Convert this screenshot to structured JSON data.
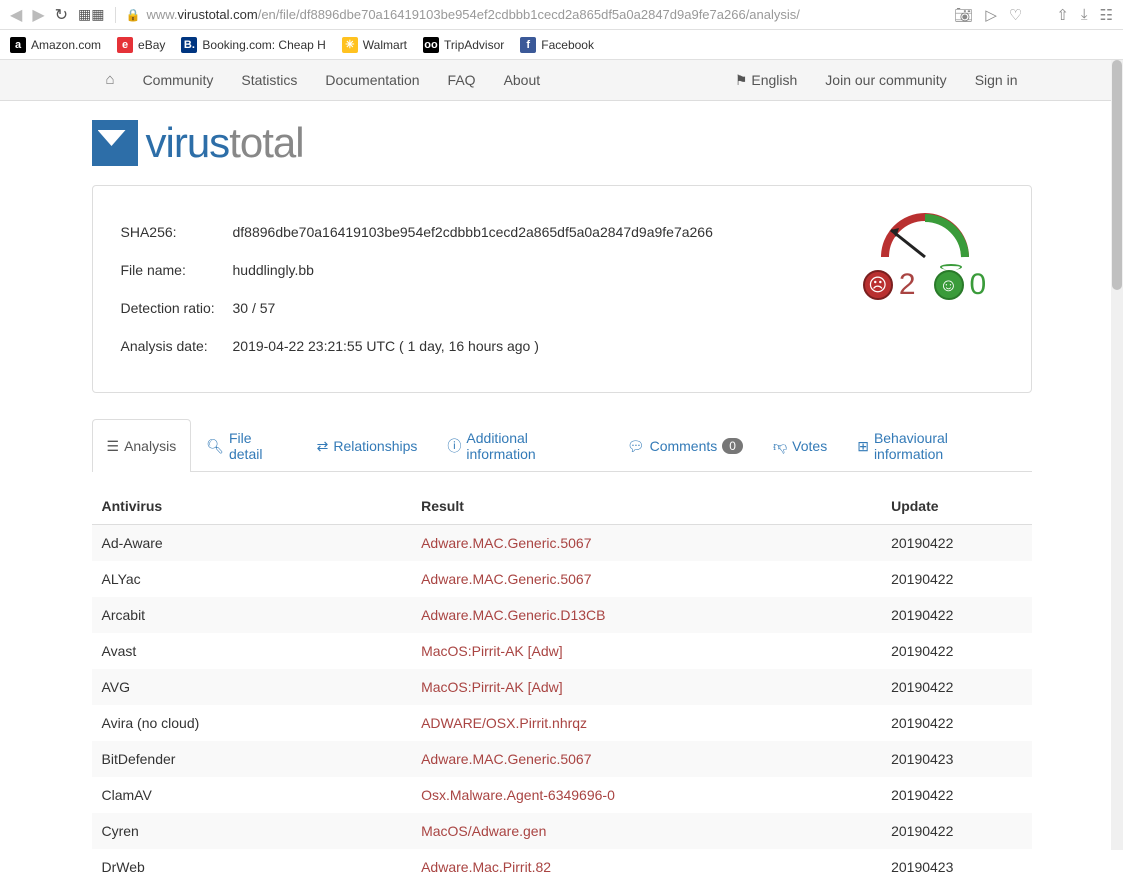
{
  "browser": {
    "url_prefix": "www.",
    "url_domain": "virustotal.com",
    "url_path": "/en/file/df8896dbe70a16419103be954ef2cdbbb1cecd2a865df5a0a2847d9a9fe7a266/analysis/",
    "bookmarks": [
      {
        "label": "Amazon.com",
        "bg": "#000",
        "letter": "a"
      },
      {
        "label": "eBay",
        "bg": "#e53238",
        "letter": "e"
      },
      {
        "label": "Booking.com: Cheap H",
        "bg": "#003580",
        "letter": "B."
      },
      {
        "label": "Walmart",
        "bg": "#ffc220",
        "letter": "✳"
      },
      {
        "label": "TripAdvisor",
        "bg": "#000",
        "letter": "oo"
      },
      {
        "label": "Facebook",
        "bg": "#3b5998",
        "letter": "f"
      }
    ]
  },
  "topnav": {
    "items": [
      "Community",
      "Statistics",
      "Documentation",
      "FAQ",
      "About"
    ],
    "language": "English",
    "join": "Join our community",
    "signin": "Sign in"
  },
  "file": {
    "sha256_label": "SHA256:",
    "sha256": "df8896dbe70a16419103be954ef2cdbbb1cecd2a865df5a0a2847d9a9fe7a266",
    "filename_label": "File name:",
    "filename": "huddlingly.bb",
    "ratio_label": "Detection ratio:",
    "ratio": "30 / 57",
    "date_label": "Analysis date:",
    "date": "2019-04-22 23:21:55 UTC ( 1 day, 16 hours ago )"
  },
  "votes": {
    "bad": "2",
    "good": "0"
  },
  "tabs": {
    "analysis": "Analysis",
    "file_detail": "File detail",
    "relationships": "Relationships",
    "additional": "Additional information",
    "comments": "Comments",
    "comments_count": "0",
    "votes": "Votes",
    "behavioural": "Behavioural information"
  },
  "table": {
    "headers": {
      "antivirus": "Antivirus",
      "result": "Result",
      "update": "Update"
    },
    "rows": [
      {
        "av": "Ad-Aware",
        "result": "Adware.MAC.Generic.5067",
        "update": "20190422"
      },
      {
        "av": "ALYac",
        "result": "Adware.MAC.Generic.5067",
        "update": "20190422"
      },
      {
        "av": "Arcabit",
        "result": "Adware.MAC.Generic.D13CB",
        "update": "20190422"
      },
      {
        "av": "Avast",
        "result": "MacOS:Pirrit-AK [Adw]",
        "update": "20190422"
      },
      {
        "av": "AVG",
        "result": "MacOS:Pirrit-AK [Adw]",
        "update": "20190422"
      },
      {
        "av": "Avira (no cloud)",
        "result": "ADWARE/OSX.Pirrit.nhrqz",
        "update": "20190422"
      },
      {
        "av": "BitDefender",
        "result": "Adware.MAC.Generic.5067",
        "update": "20190423"
      },
      {
        "av": "ClamAV",
        "result": "Osx.Malware.Agent-6349696-0",
        "update": "20190422"
      },
      {
        "av": "Cyren",
        "result": "MacOS/Adware.gen",
        "update": "20190422"
      },
      {
        "av": "DrWeb",
        "result": "Adware.Mac.Pirrit.82",
        "update": "20190423"
      }
    ]
  }
}
